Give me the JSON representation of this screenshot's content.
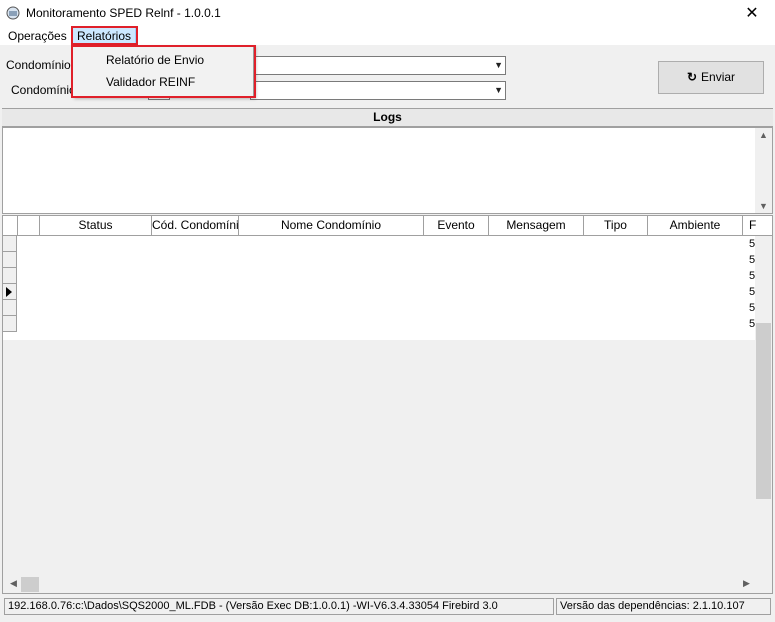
{
  "window": {
    "title": "Monitoramento SPED Relnf - 1.0.0.1",
    "close_label": "✕"
  },
  "menu": {
    "operacoes": "Operações",
    "relatorios": "Relatórios",
    "dropdown": [
      "Relatório de Envio",
      "Validador REINF"
    ]
  },
  "filters": {
    "label1": "Condomínio I",
    "label2": "Condomínio",
    "enviar_label": "Enviar",
    "refresh_glyph": "↻"
  },
  "logs": {
    "title": "Logs"
  },
  "grid": {
    "columns": [
      "",
      "",
      "Status",
      "Cód. Condomínio",
      "Nome Condomínio",
      "Evento",
      "Mensagem",
      "Tipo",
      "Ambiente",
      "F"
    ],
    "last_col_values": [
      "5",
      "5",
      "5",
      "5",
      "5",
      "5"
    ]
  },
  "statusbar": {
    "left": "192.168.0.76:c:\\Dados\\SQS2000_ML.FDB - (Versão Exec DB:1.0.0.1) -WI-V6.3.4.33054 Firebird 3.0",
    "right": "Versão das dependências: 2.1.10.107"
  },
  "colors": {
    "highlight": "#e0202a",
    "menu_selected": "#cce8ff"
  }
}
